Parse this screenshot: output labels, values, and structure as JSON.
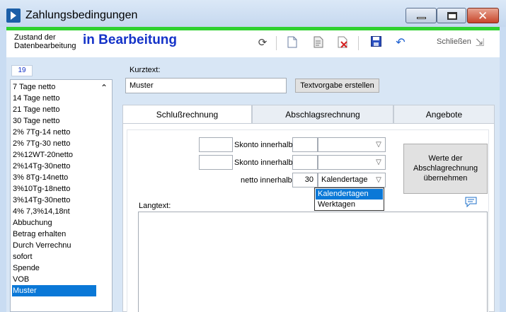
{
  "window": {
    "title": "Zahlungsbedingungen"
  },
  "toolbar": {
    "state_label": "Zustand der Datenbearbeitung",
    "state_value": "in Bearbeitung",
    "close_label": "Schließen"
  },
  "sidebar": {
    "count": "19",
    "items": [
      " 7 Tage netto",
      " 14 Tage netto",
      " 21 Tage netto",
      " 30 Tage netto",
      "2% 7Tg-14 netto",
      "2% 7Tg-30 netto",
      "2%12WT-20netto",
      "2%14Tg-30netto",
      "3% 8Tg-14netto",
      "3%10Tg-18netto",
      "3%14Tg-30netto",
      "4% 7,3%14,18nt",
      "Abbuchung",
      "Betrag erhalten",
      "Durch Verrechnu",
      "sofort",
      "Spende",
      "VOB",
      "Muster"
    ],
    "selected_index": 18
  },
  "form": {
    "kurztext_label": "Kurztext:",
    "kurztext_value": "Muster",
    "textvorgabe_button": "Textvorgabe erstellen",
    "tabs": [
      "Schlußrechnung",
      "Abschlagsrechnung",
      "Angebote"
    ],
    "active_tab": 0,
    "skonto1_label": "Skonto innerhalb",
    "skonto2_label": "Skonto innerhalb",
    "netto_label": "netto innerhalb",
    "netto_days": "30",
    "netto_unit": "Kalendertage",
    "werte_button": "Werte der Abschlagrechnung übernehmen",
    "dropdown_options": [
      "Kalendertagen",
      "Werktagen"
    ],
    "langtext_label": "Langtext:"
  }
}
